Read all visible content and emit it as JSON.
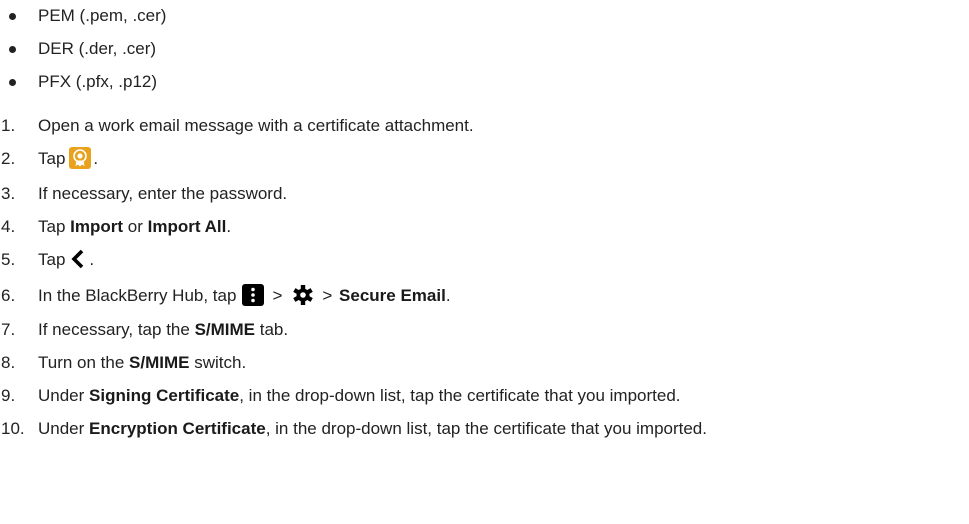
{
  "bullets": [
    "PEM (.pem, .cer)",
    "DER (.der, .cer)",
    "PFX (.pfx, .p12)"
  ],
  "steps": [
    {
      "num": "1.",
      "text": "Open a work email message with a certificate attachment."
    },
    {
      "num": "2.",
      "before": "Tap",
      "after": "."
    },
    {
      "num": "3.",
      "text": "If necessary, enter the password."
    },
    {
      "num": "4.",
      "before": "Tap",
      "bold1": "Import",
      "mid": "or",
      "bold2": "Import All",
      "after": "."
    },
    {
      "num": "5.",
      "before": "Tap",
      "after": "."
    },
    {
      "num": "6.",
      "before": "In the BlackBerry Hub, tap",
      "sep1": ">",
      "sep2": ">",
      "bold": "Secure Email",
      "after": "."
    },
    {
      "num": "7.",
      "before": "If necessary, tap the",
      "bold": "S/MIME",
      "after": "tab."
    },
    {
      "num": "8.",
      "before": "Turn on the",
      "bold": "S/MIME",
      "after": "switch."
    },
    {
      "num": "9.",
      "before": "Under",
      "bold": "Signing Certificate",
      "after": ", in the drop-down list, tap the certificate that you imported."
    },
    {
      "num": "10.",
      "before": "Under",
      "bold": "Encryption Certificate",
      "after": ", in the drop-down list, tap the certificate that you imported."
    }
  ],
  "icons": {
    "certificate": "certificate-icon",
    "back": "back-chevron-icon",
    "overflow": "overflow-menu-icon",
    "settings": "gear-icon"
  },
  "colors": {
    "certificate_icon": "#e8a21e",
    "text": "#222222"
  }
}
